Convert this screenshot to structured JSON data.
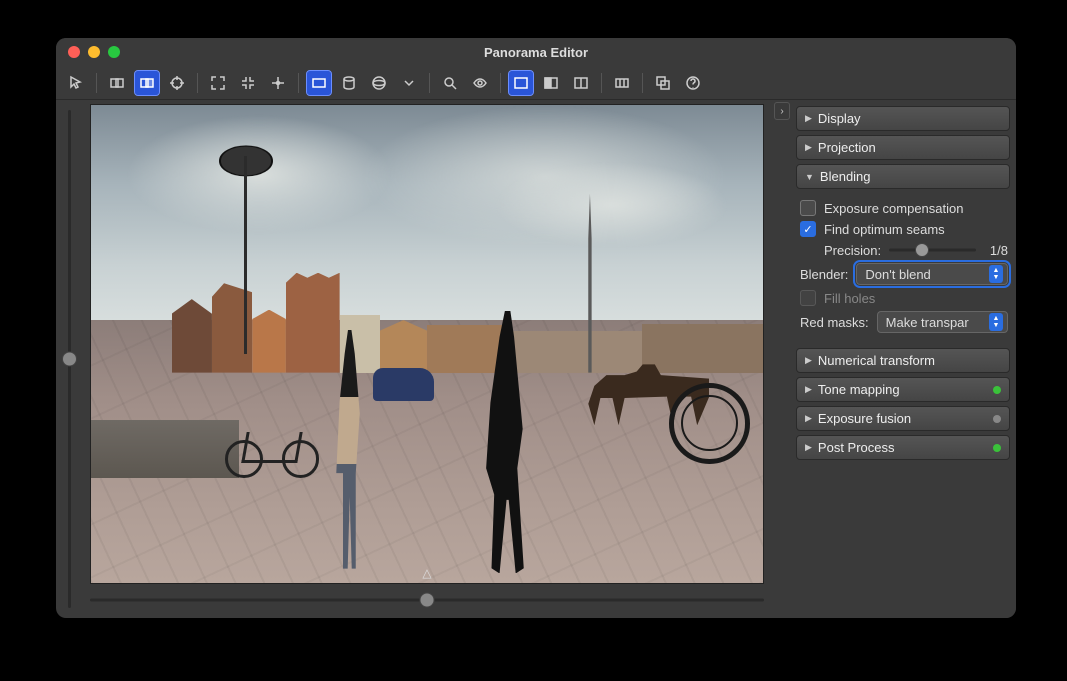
{
  "window": {
    "title": "Panorama Editor"
  },
  "toolbar": {
    "icons": [
      "cursor",
      "overlap",
      "overlap-active",
      "crosshair",
      "fit",
      "shrink",
      "center",
      "rect",
      "cylinder",
      "sphere",
      "dropdown",
      "zoom",
      "eye",
      "screen",
      "half",
      "book",
      "crop-ratio",
      "windows",
      "help"
    ]
  },
  "panel": {
    "sections": {
      "display": {
        "label": "Display",
        "expanded": false
      },
      "projection": {
        "label": "Projection",
        "expanded": false
      },
      "blending": {
        "label": "Blending",
        "expanded": true,
        "exposure_comp_label": "Exposure compensation",
        "exposure_comp_checked": false,
        "find_seams_label": "Find optimum seams",
        "find_seams_checked": true,
        "precision_label": "Precision:",
        "precision_value": "1/8",
        "blender_label": "Blender:",
        "blender_value": "Don't blend",
        "fill_holes_label": "Fill holes",
        "fill_holes_enabled": false,
        "red_masks_label": "Red masks:",
        "red_masks_value": "Make transpar"
      },
      "numerical": {
        "label": "Numerical transform",
        "expanded": false
      },
      "tonemap": {
        "label": "Tone mapping",
        "expanded": false,
        "status": "green"
      },
      "expfusion": {
        "label": "Exposure fusion",
        "expanded": false,
        "status": "gray"
      },
      "postproc": {
        "label": "Post Process",
        "expanded": false,
        "status": "green"
      }
    }
  },
  "canvas": {
    "marker": "△"
  }
}
